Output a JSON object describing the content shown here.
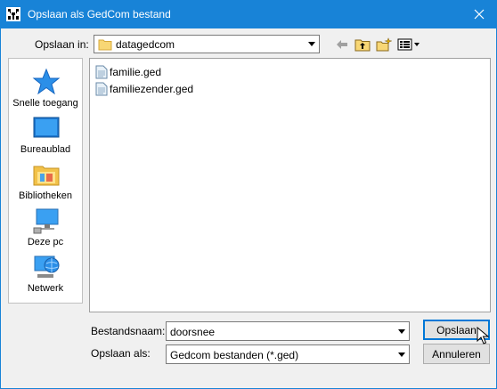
{
  "window": {
    "title": "Opslaan als GedCom bestand",
    "title_icon": "ancestry-tree-icon",
    "close_icon": "close-icon"
  },
  "lookin": {
    "label": "Opslaan in:",
    "value": "datagedcom"
  },
  "toolbar": {
    "icons": [
      "back-arrow-icon",
      "up-folder-icon",
      "new-folder-icon",
      "view-menu-icon"
    ]
  },
  "places": [
    {
      "label": "Snelle toegang",
      "icon": "star-icon"
    },
    {
      "label": "Bureaublad",
      "icon": "desktop-icon"
    },
    {
      "label": "Bibliotheken",
      "icon": "library-icon"
    },
    {
      "label": "Deze pc",
      "icon": "computer-icon"
    },
    {
      "label": "Netwerk",
      "icon": "network-icon"
    }
  ],
  "files": [
    {
      "name": "familie.ged",
      "icon": "file-icon"
    },
    {
      "name": "familiezender.ged",
      "icon": "file-icon"
    }
  ],
  "filename": {
    "label": "Bestandsnaam:",
    "value": "doorsnee"
  },
  "filetype": {
    "label": "Opslaan als:",
    "value": "Gedcom bestanden (*.ged)"
  },
  "buttons": {
    "save": "Opslaan",
    "cancel": "Annuleren"
  },
  "colors": {
    "titlebar": "#1883d7",
    "dialog_bg": "#f0f0f0",
    "focus_border": "#0078d7"
  }
}
